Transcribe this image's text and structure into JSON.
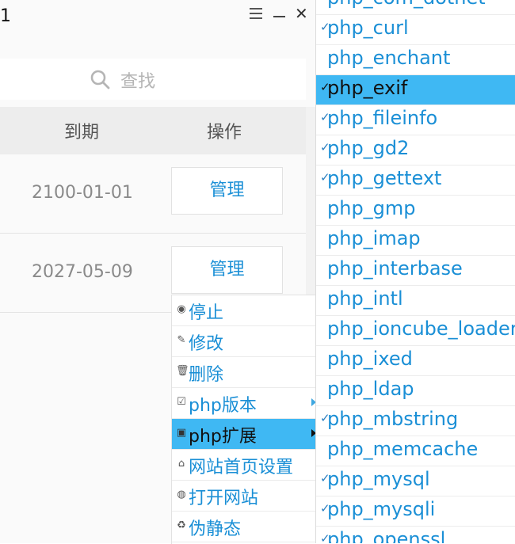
{
  "window": {
    "title": "1"
  },
  "search": {
    "placeholder": "查找"
  },
  "table": {
    "headers": {
      "expire": "到期",
      "action": "操作"
    },
    "rows": [
      {
        "expire": "2100-01-01",
        "action": "管理"
      },
      {
        "expire": "2027-05-09",
        "action": "管理"
      }
    ]
  },
  "context_menu": {
    "items": [
      {
        "label": "停止",
        "icon": "stop-icon",
        "glyph": "◉"
      },
      {
        "label": "修改",
        "icon": "pencil-icon",
        "glyph": "✎"
      },
      {
        "label": "删除",
        "icon": "trash-icon",
        "glyph": "🗑"
      },
      {
        "label": "php版本",
        "icon": "php-version-icon",
        "glyph": "☑",
        "submenu": true
      },
      {
        "label": "php扩展",
        "icon": "php-extension-icon",
        "glyph": "▣",
        "submenu": true,
        "active": true
      },
      {
        "label": "网站首页设置",
        "icon": "home-icon",
        "glyph": "⌂"
      },
      {
        "label": "打开网站",
        "icon": "globe-icon",
        "glyph": "◍"
      },
      {
        "label": "伪静态",
        "icon": "rewrite-icon",
        "glyph": "♻"
      }
    ]
  },
  "submenu": {
    "items": [
      {
        "label": "php_com_dotnet",
        "checked": false
      },
      {
        "label": "php_curl",
        "checked": true
      },
      {
        "label": "php_enchant",
        "checked": false
      },
      {
        "label": "php_exif",
        "checked": true,
        "active": true
      },
      {
        "label": "php_fileinfo",
        "checked": true
      },
      {
        "label": "php_gd2",
        "checked": true
      },
      {
        "label": "php_gettext",
        "checked": true
      },
      {
        "label": "php_gmp",
        "checked": false
      },
      {
        "label": "php_imap",
        "checked": false
      },
      {
        "label": "php_interbase",
        "checked": false
      },
      {
        "label": "php_intl",
        "checked": false
      },
      {
        "label": "php_ioncube_loader",
        "checked": false
      },
      {
        "label": "php_ixed",
        "checked": false
      },
      {
        "label": "php_ldap",
        "checked": false
      },
      {
        "label": "php_mbstring",
        "checked": true
      },
      {
        "label": "php_memcache",
        "checked": false
      },
      {
        "label": "php_mysql",
        "checked": true
      },
      {
        "label": "php_mysqli",
        "checked": true
      },
      {
        "label": "php_openssl",
        "checked": true
      }
    ]
  },
  "colors": {
    "accent": "#1a8fd6",
    "highlight": "#3fb8f3"
  }
}
